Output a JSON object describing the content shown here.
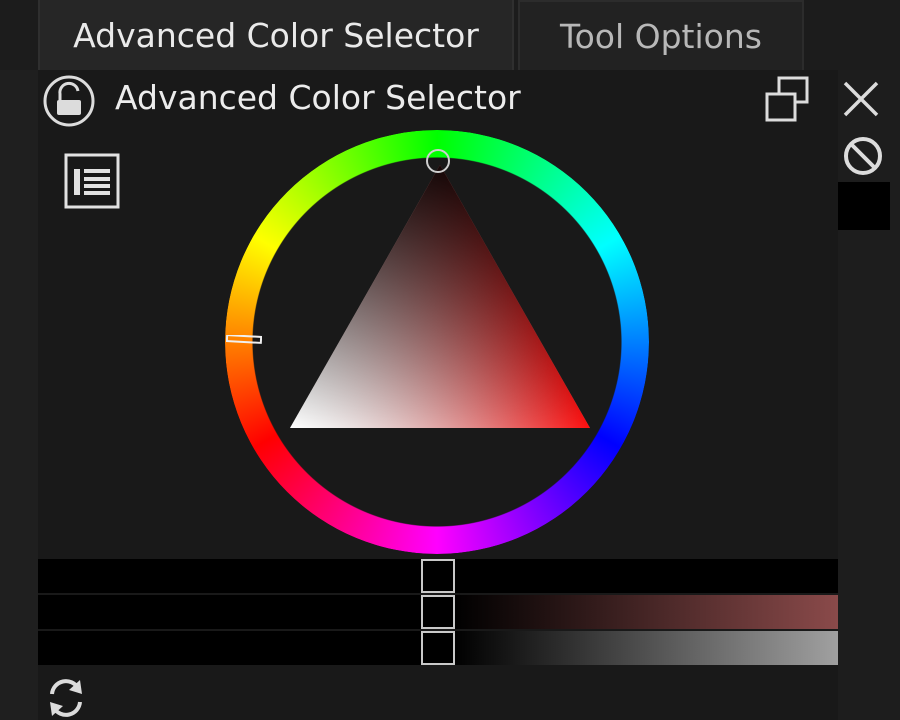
{
  "tabs": [
    {
      "label": "Advanced Color Selector",
      "active": true
    },
    {
      "label": "Tool Options",
      "active": false
    }
  ],
  "docker": {
    "title": "Advanced Color Selector",
    "icons": {
      "lock": "lock-icon",
      "float": "float-icon",
      "close": "close-icon",
      "settings": "settings-icon",
      "clear": "no-color-icon",
      "refresh": "refresh-icon"
    }
  },
  "selector": {
    "hue_marker_colour": "#ff0000",
    "triangle_hue": "#ff0000"
  },
  "colors": {
    "background": "#191919",
    "bar_red_tint": "#8a4a4a",
    "bar_gray": "#a0a0a0"
  }
}
